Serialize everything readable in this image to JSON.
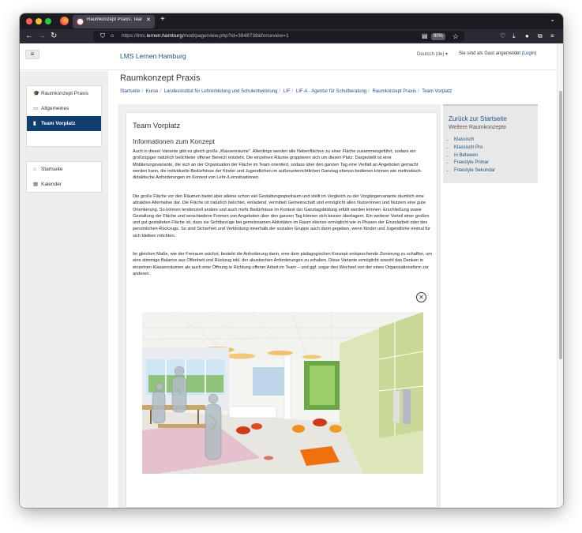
{
  "browser": {
    "tab_title": "Raumkonzept Praxis: Team Vorplatz",
    "tab_close": "✕",
    "new_tab": "+",
    "tab_list": "⌄",
    "url_prefix": "https://lms.",
    "url_domain": "lernen.hamburg",
    "url_path": "/mod/page/view.php?id=3848738&forceview=1",
    "zoom": "90%",
    "icons": [
      "back-arrow-icon",
      "forward-arrow-icon",
      "reload-icon",
      "shield-icon",
      "lock-icon",
      "reader-view-icon",
      "bookmark-star-icon",
      "pocket-icon",
      "download-icon",
      "account-icon",
      "extensions-icon",
      "menu-icon"
    ]
  },
  "header": {
    "menu_button": "≡",
    "site_name": "LMS Lernen Hamburg",
    "language": "Deutsch (de) ▾",
    "login_text": "Sie sind als Gast angemeldet (",
    "login_link": "Login",
    "login_suffix": ")"
  },
  "nav": {
    "items": [
      {
        "label": "Raumkonzept Praxis",
        "icon": "graduation-cap-icon"
      },
      {
        "label": "Allgemeines",
        "icon": "folder-icon"
      },
      {
        "label": "Team Vorplatz",
        "icon": "file-icon",
        "active": true
      }
    ],
    "items2": [
      {
        "label": "Startseite",
        "icon": "home-icon"
      },
      {
        "label": "Kalender",
        "icon": "calendar-icon"
      }
    ]
  },
  "page": {
    "heading": "Raumkonzept Praxis",
    "breadcrumb": [
      "Startseite",
      "Kurse",
      "Landesinstitut für Lehrerbildung und Schulentwicklung",
      "LIF",
      "LIF-A - Agentur für Schulberatung",
      "Raumkonzept Praxis",
      "Team Vorplatz"
    ],
    "activity_title": "Team Vorplatz",
    "section_title": "Informationen zum Konzept",
    "paragraphs": [
      "Auch in dieser Variante gibt es gleich große „Klassenräume\". Allerdings werden alle Nebenflächen zu einer Fläche zusammengeführt, sodass ein großzügiger natürlich belichteter offener Bereich entsteht. Die einzelnen Räume gruppieren sich um diesen Platz. Dargestellt ist eine Möblierungsvariante, die sich an der Organisation der Fläche im Team orientiert, sodass über den ganzen Tag eine Vielfalt an Angeboten gemacht werden kann, die individuelle Bedürfnisse der Kinder und Jugendlichen im außerunterrichtlichen Ganztag ebenso bedienen können wie methodisch-didaktische Anforderungen im Kontext von Lehr-/Lernsituationen.",
      "Die große Fläche vor den Räumen bietet aber alleine schon viel Gestaltungsspielraum und stellt im Vergleich zu der Vorgängervariante räumlich eine attraktive Alternative dar. Die Fläche ist natürlich belichtet, einladend, vermittelt Gemeinschaft und ermöglicht allen Nutzerinnen und Nutzern eine gute Orientierung. So können tendenziell andere und auch mehr Bedürfnisse im Kontext der Ganztagsbildung erfüllt werden können. Erschließung sowie Gestaltung der Fläche und verschiedene Formen von Angeboten über den ganzen Tag können sich besser überlagern. Ein weiterer Vorteil einer großen und gut gestalteten Fläche ist, dass sie Sichtbezüge bei gemeinsamen Aktivitäten im Raum ebenso ermöglicht wie in Phasen der Einzelarbeit oder des persönlichen Rückzugs. So sind Sicherheit und Verbindung innerhalb der sozialen Gruppe auch dann gegeben, wenn Kinder und Jugendliche einmal für sich bleiben möchten.",
      "Im gleichen Maße, wie der Freiraum wächst, besteht die Anforderung darin, eine dem pädagogischen Konzept entsprechende Zonierung zu schaffen, um eine stimmige Balance aus Offenheit und Rückzug inkl. der akustischen Anforderungen zu erhalten. Diese Variante ermöglicht sowohl das Denken in einzelnen Klassenräumen als auch eine Öffnung in Richtung offener Arbeit im Team – und ggf. sogar den Wechsel von der einen Organisationsform zur anderen."
    ],
    "close_button": "✕"
  },
  "sidebar": {
    "title": "Zurück zur Startseite",
    "subtitle": "Weitere Raumkonzepte",
    "links": [
      "Klassisch",
      "Klassisch Pro",
      "In Between",
      "Freestyle Primar",
      "Freestyle Sekundar"
    ]
  },
  "colors": {
    "brand_link": "#1a4f86",
    "nav_active": "#0f3e6f",
    "browser_chrome": "#1c1b22"
  }
}
